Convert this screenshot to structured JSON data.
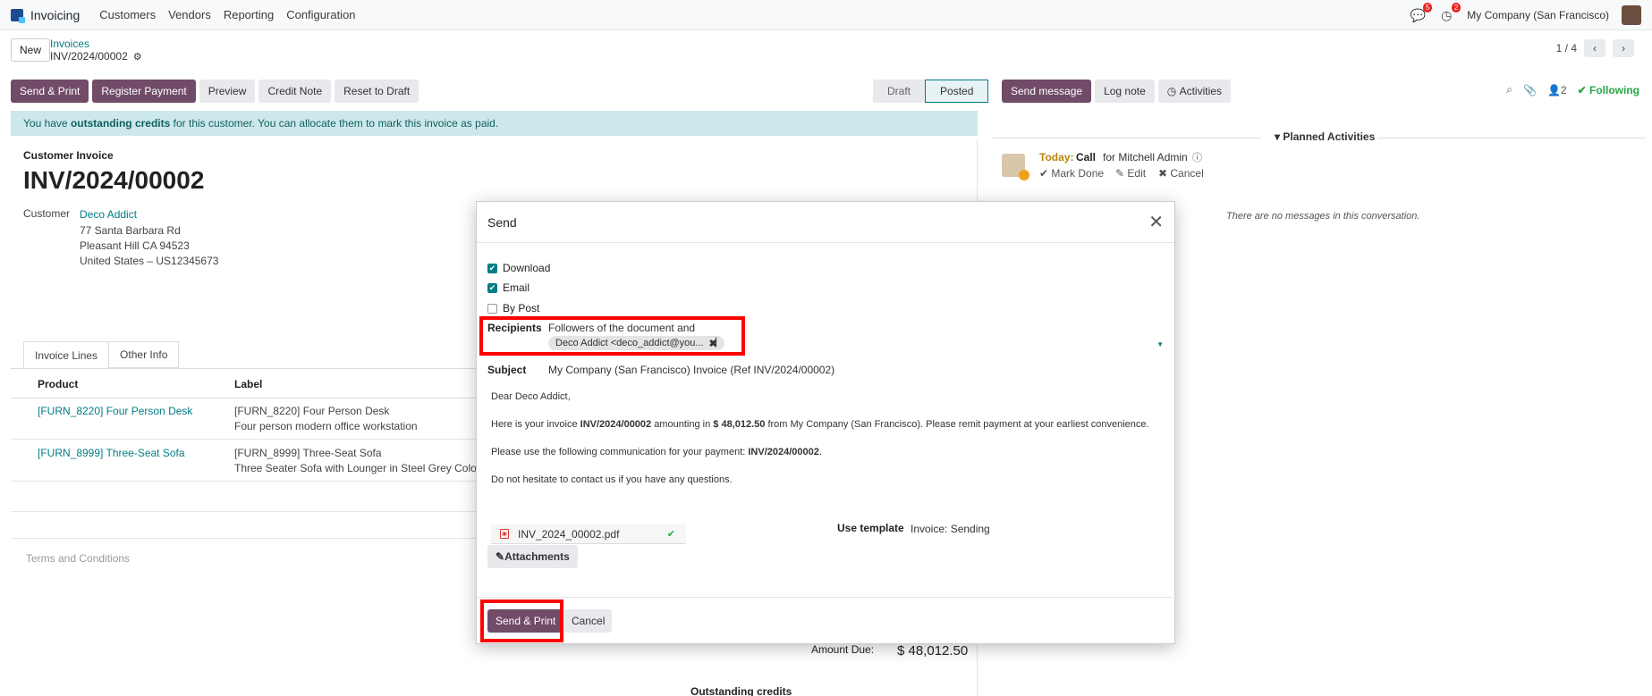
{
  "navbar": {
    "app_name": "Invoicing",
    "menus": [
      "Customers",
      "Vendors",
      "Reporting",
      "Configuration"
    ],
    "messages_badge": "5",
    "activities_badge": "2",
    "company": "My Company (San Francisco)"
  },
  "control": {
    "new_label": "New",
    "breadcrumb_parent": "Invoices",
    "breadcrumb_current": "INV/2024/00002",
    "pager": "1 / 4"
  },
  "actions": {
    "send_print": "Send & Print",
    "register_payment": "Register Payment",
    "preview": "Preview",
    "credit_note": "Credit Note",
    "reset_to_draft": "Reset to Draft"
  },
  "status": {
    "draft": "Draft",
    "posted": "Posted"
  },
  "alert": {
    "prefix": "You have ",
    "bold": "outstanding credits",
    "suffix": " for this customer. You can allocate them to mark this invoice as paid."
  },
  "form": {
    "type_label": "Customer Invoice",
    "number": "INV/2024/00002",
    "customer_label": "Customer",
    "customer_name": "Deco Addict",
    "address_1": "77 Santa Barbara Rd",
    "address_2": "Pleasant Hill CA 94523",
    "address_3": "United States – US12345673",
    "tab_lines": "Invoice Lines",
    "tab_other": "Other Info",
    "col_product": "Product",
    "col_label": "Label",
    "line1_product": "[FURN_8220] Four Person Desk",
    "line1_label": "[FURN_8220] Four Person Desk",
    "line1_desc": "Four person modern office workstation",
    "line2_product": "[FURN_8999] Three-Seat Sofa",
    "line2_label": "[FURN_8999] Three-Seat Sofa",
    "line2_desc": "Three Seater Sofa with Lounger in Steel Grey Colour",
    "terms": "Terms and Conditions",
    "amount_due_label": "Amount Due:",
    "amount_due": "$ 48,012.50",
    "outstanding_credits": "Outstanding credits"
  },
  "chatter": {
    "send_message": "Send message",
    "log_note": "Log note",
    "activities": "Activities",
    "followers_count": "2",
    "following": "Following",
    "planned_activities": "Planned Activities",
    "today": "Today:",
    "activity_type": "Call",
    "activity_for": "for Mitchell Admin",
    "mark_done": "Mark Done",
    "edit": "Edit",
    "cancel": "Cancel",
    "no_messages": "There are no messages in this conversation."
  },
  "modal": {
    "title": "Send",
    "download": "Download",
    "email": "Email",
    "by_post": "By Post",
    "recipients_label": "Recipients",
    "recipients_text": "Followers of the document and",
    "recipient_tag": "Deco Addict <deco_addict@you...",
    "subject_label": "Subject",
    "subject_value": "My Company (San Francisco) Invoice (Ref INV/2024/00002)",
    "greeting": "Dear Deco Addict,",
    "line1_a": "Here is your invoice ",
    "line1_b": "INV/2024/00002",
    "line1_c": " amounting in ",
    "line1_d": "$ 48,012.50",
    "line1_e": " from My Company (San Francisco). Please remit payment at your earliest convenience.",
    "line2_a": "Please use the following communication for your payment: ",
    "line2_b": "INV/2024/00002",
    "line2_c": ".",
    "line3": "Do not hesitate to contact us if you have any questions.",
    "attachment_name": "INV_2024_00002.pdf",
    "attachments_btn": "Attachments",
    "use_template_label": "Use template",
    "use_template_value": "Invoice: Sending",
    "send_print_btn": "Send & Print",
    "cancel_btn": "Cancel"
  },
  "colors": {
    "primary": "#714b67",
    "teal": "#017e84",
    "highlight": "#ff0000"
  }
}
